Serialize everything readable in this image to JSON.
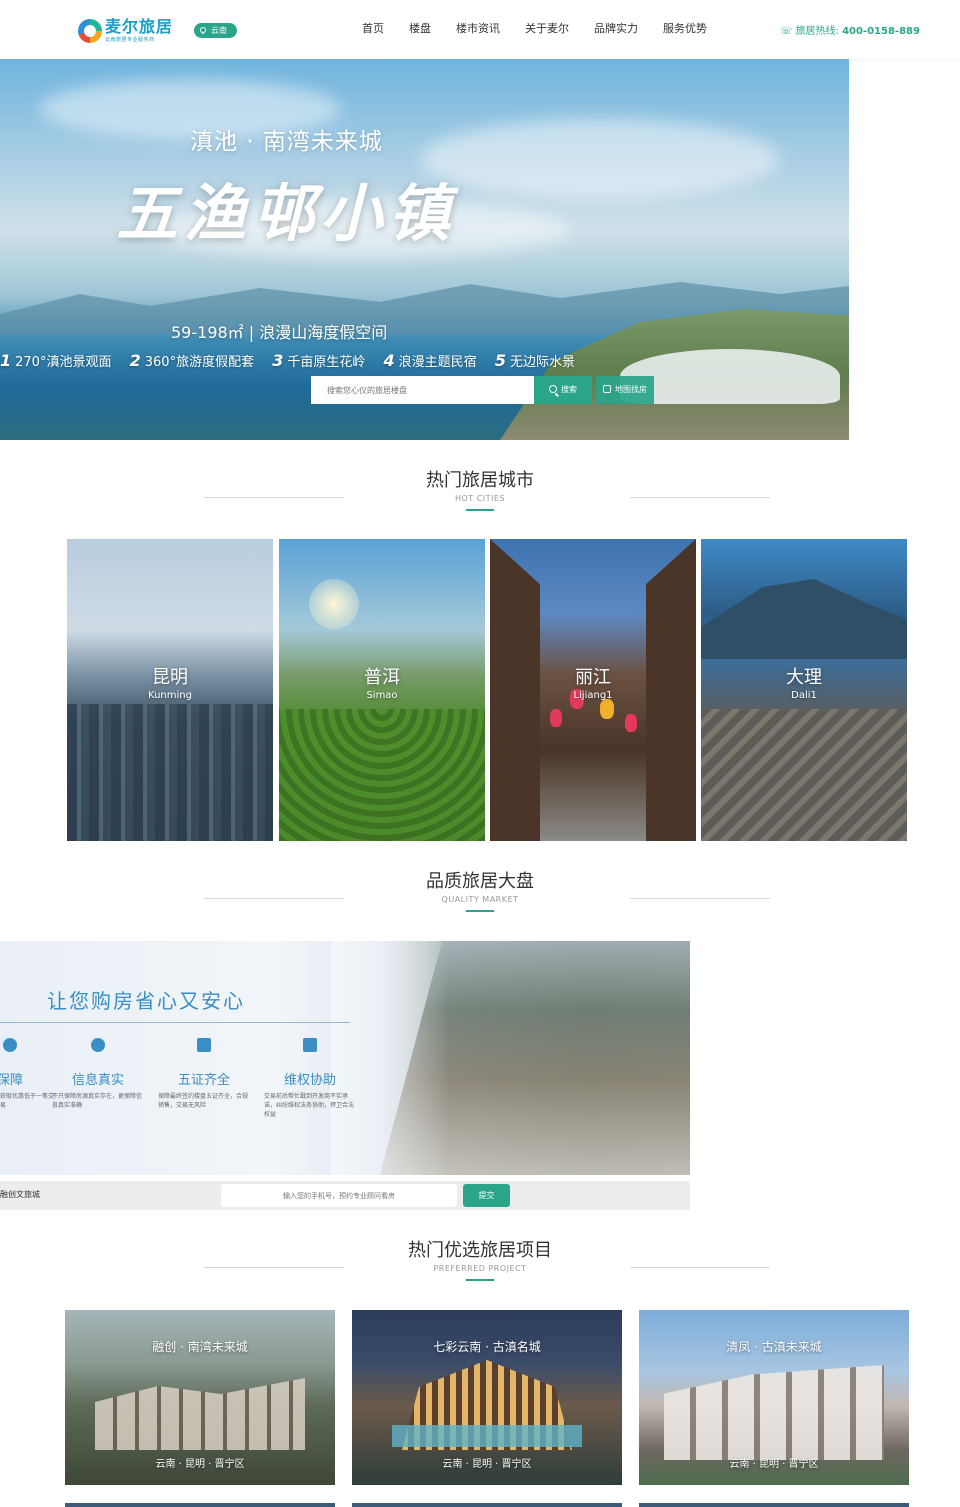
{
  "header": {
    "brand": "麦尔旅居",
    "brand_sub": "云南旅居专业服务商",
    "region": "云南",
    "nav": [
      "首页",
      "楼盘",
      "楼市资讯",
      "关于麦尔",
      "品牌实力",
      "服务优势"
    ],
    "hotline_label": "旅居热线:",
    "hotline_number": "400-0158-889"
  },
  "hero": {
    "subtitle": "滇池 · 南湾未来城",
    "title": "五渔邨小镇",
    "area": "59-198㎡ | 浪漫山海度假空间",
    "features": [
      {
        "num": "1",
        "text": "270°滇池景观面"
      },
      {
        "num": "2",
        "text": "360°旅游度假配套"
      },
      {
        "num": "3",
        "text": "千亩原生花岭"
      },
      {
        "num": "4",
        "text": "浪漫主题民宿"
      },
      {
        "num": "5",
        "text": "无边际水景"
      }
    ],
    "search_placeholder": "搜索您心仪的旅居楼盘",
    "search_button": "搜索",
    "map_button": "地图找房"
  },
  "cities_section": {
    "title": "热门旅居城市",
    "subtitle": "HOT CITIES"
  },
  "cities": [
    {
      "name": "昆明",
      "en": "Kunming"
    },
    {
      "name": "普洱",
      "en": "Simao"
    },
    {
      "name": "丽江",
      "en": "Lijiang1"
    },
    {
      "name": "大理",
      "en": "Dali1"
    }
  ],
  "quality_section": {
    "title": "品质旅居大盘",
    "subtitle": "QUALITY MARKET"
  },
  "quality": {
    "headline": "让您购房省心又安心",
    "items": [
      {
        "name": "保障",
        "desc": "获取优惠低于一笔交易"
      },
      {
        "name": "信息真实",
        "desc": "不只保障房源真实存在，更保障信息真实准确"
      },
      {
        "name": "五证齐全",
        "desc": "保障最终签约楼盘五证齐全，合规销售，交易无风险"
      },
      {
        "name": "维权协助",
        "desc": "交易前后帮忙戳到开发商不实承诺，纠纷维权法务协助，捍卫合法权益"
      }
    ],
    "form_label": "融创文旅城",
    "phone_placeholder": "输入您的手机号，预约专业顾问看房",
    "submit": "提交"
  },
  "projects_section": {
    "title": "热门优选旅居项目",
    "subtitle": "PREFERRED PROJECT"
  },
  "projects": [
    {
      "name": "融创 · 南湾未来城",
      "location": "云南 · 昆明 · 晋宁区"
    },
    {
      "name": "七彩云南 · 古滇名城",
      "location": "云南 · 昆明 · 晋宁区"
    },
    {
      "name": "清凤 · 古滇未来城",
      "location": "云南 · 昆明 · 晋宁区"
    }
  ],
  "colors": {
    "accent": "#2aa58a",
    "brand": "#19a0c4",
    "quality_blue": "#3b8ec4"
  }
}
